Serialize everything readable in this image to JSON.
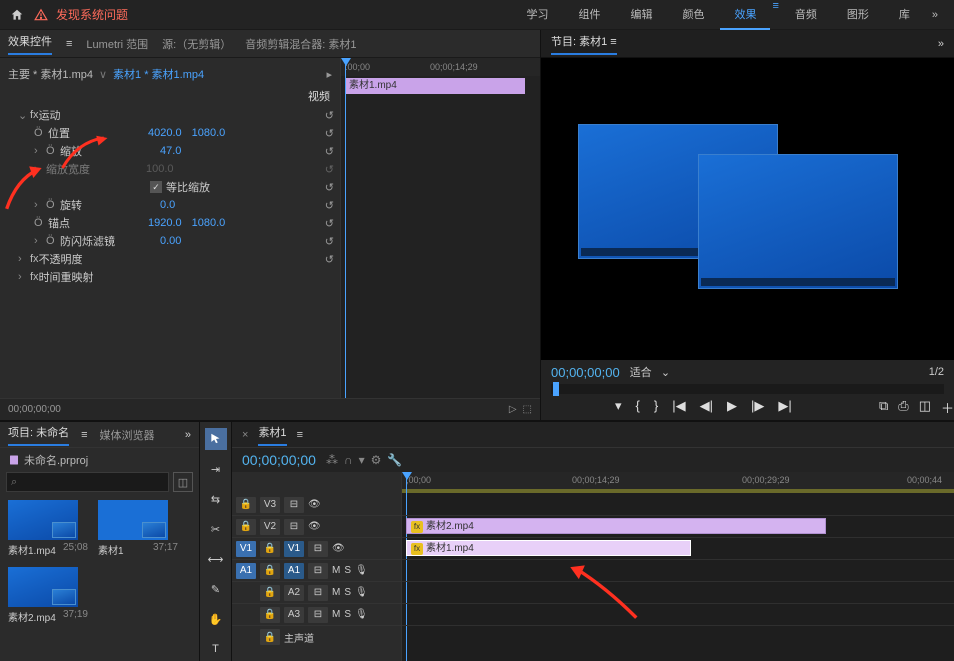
{
  "topbar": {
    "warning": "发现系统问题",
    "tabs": [
      "学习",
      "组件",
      "编辑",
      "颜色",
      "效果",
      "音频",
      "图形",
      "库"
    ],
    "active_tab": 4
  },
  "effect_controls_panel": {
    "tabs": [
      "效果控件",
      "Lumetri 范围",
      "源:（无剪辑）",
      "音频剪辑混合器: 素材1"
    ],
    "breadcrumb_master": "主要 * 素材1.mp4",
    "breadcrumb_current": "素材1 * 素材1.mp4",
    "section_video": "视频",
    "fx_motion": "运动",
    "prop_position_label": "位置",
    "prop_position_x": "4020.0",
    "prop_position_y": "1080.0",
    "prop_scale_label": "缩放",
    "prop_scale_val": "47.0",
    "prop_scale_width_label": "缩放宽度",
    "prop_scale_width_val": "100.0",
    "uniform_scale_label": "等比缩放",
    "prop_rotation_label": "旋转",
    "prop_rotation_val": "0.0",
    "prop_anchor_label": "锚点",
    "prop_anchor_x": "1920.0",
    "prop_anchor_y": "1080.0",
    "prop_antiflicker_label": "防闪烁滤镜",
    "prop_antiflicker_val": "0.00",
    "fx_opacity": "不透明度",
    "fx_timeremap": "时间重映射",
    "mini_tc_start": ":00;00",
    "mini_tc_mid": "00;00;14;29",
    "mini_clip_label": "素材1.mp4",
    "footer_tc": "00;00;00;00"
  },
  "program_panel": {
    "title": "节目: 素材1",
    "tc": "00;00;00;00",
    "fit_label": "适合",
    "scale_label": "1/2"
  },
  "project_panel": {
    "tab_project": "项目: 未命名",
    "tab_browser": "媒体浏览器",
    "project_file": "未命名.prproj",
    "bins": [
      {
        "label": "素材1.mp4",
        "dur": "25;08"
      },
      {
        "label": "素材1",
        "dur": "37;17"
      },
      {
        "label": "素材2.mp4",
        "dur": "37;19"
      }
    ]
  },
  "timeline_panel": {
    "tab": "素材1",
    "tc": "00;00;00;00",
    "ruler_ticks": [
      ";00;00",
      "00;00;14;29",
      "00;00;29;29",
      "00;00;44"
    ],
    "tracks_v": [
      "V3",
      "V2",
      "V1"
    ],
    "tracks_a": [
      "A1",
      "A2",
      "A3"
    ],
    "target_v": "V1",
    "target_a": "A1",
    "master_label": "主声道",
    "clip_v2": "素材2.mp4",
    "clip_v1": "素材1.mp4"
  }
}
